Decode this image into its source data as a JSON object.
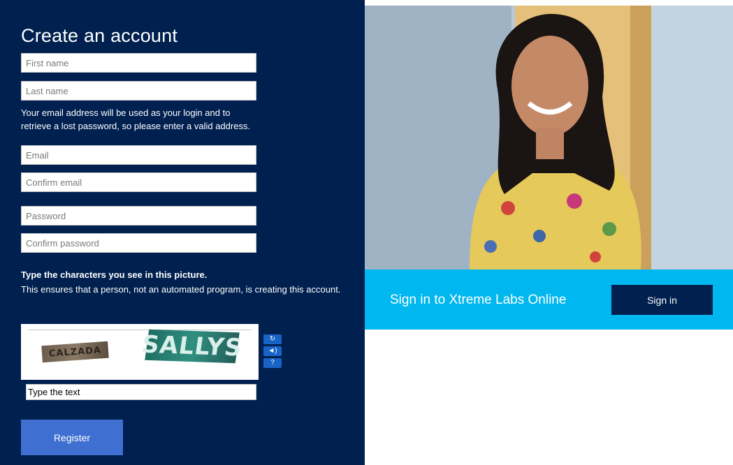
{
  "form": {
    "title": "Create an account",
    "first_name_placeholder": "First name",
    "last_name_placeholder": "Last name",
    "email_note_line1": "Your email address will be used as your login and to",
    "email_note_line2": "retrieve a lost password, so please enter a valid address.",
    "email_placeholder": "Email",
    "confirm_email_placeholder": "Confirm email",
    "password_placeholder": "Password",
    "confirm_password_placeholder": "Confirm password"
  },
  "captcha": {
    "heading": "Type the characters you see in this picture.",
    "description": "This ensures that a person, not an automated program, is creating this account.",
    "image_word1": "CALZADA",
    "image_word2": "SALLYS",
    "input_placeholder": "Type the text",
    "refresh_icon": "refresh-icon",
    "audio_icon": "audio-icon",
    "help_icon": "help-icon"
  },
  "register_label": "Register",
  "signin": {
    "text": "Sign in to Xtreme Labs Online",
    "button_label": "Sign in"
  },
  "colors": {
    "panel_bg": "#00204f",
    "signin_bar": "#00b7ef",
    "register_button": "#3f6fd0"
  }
}
